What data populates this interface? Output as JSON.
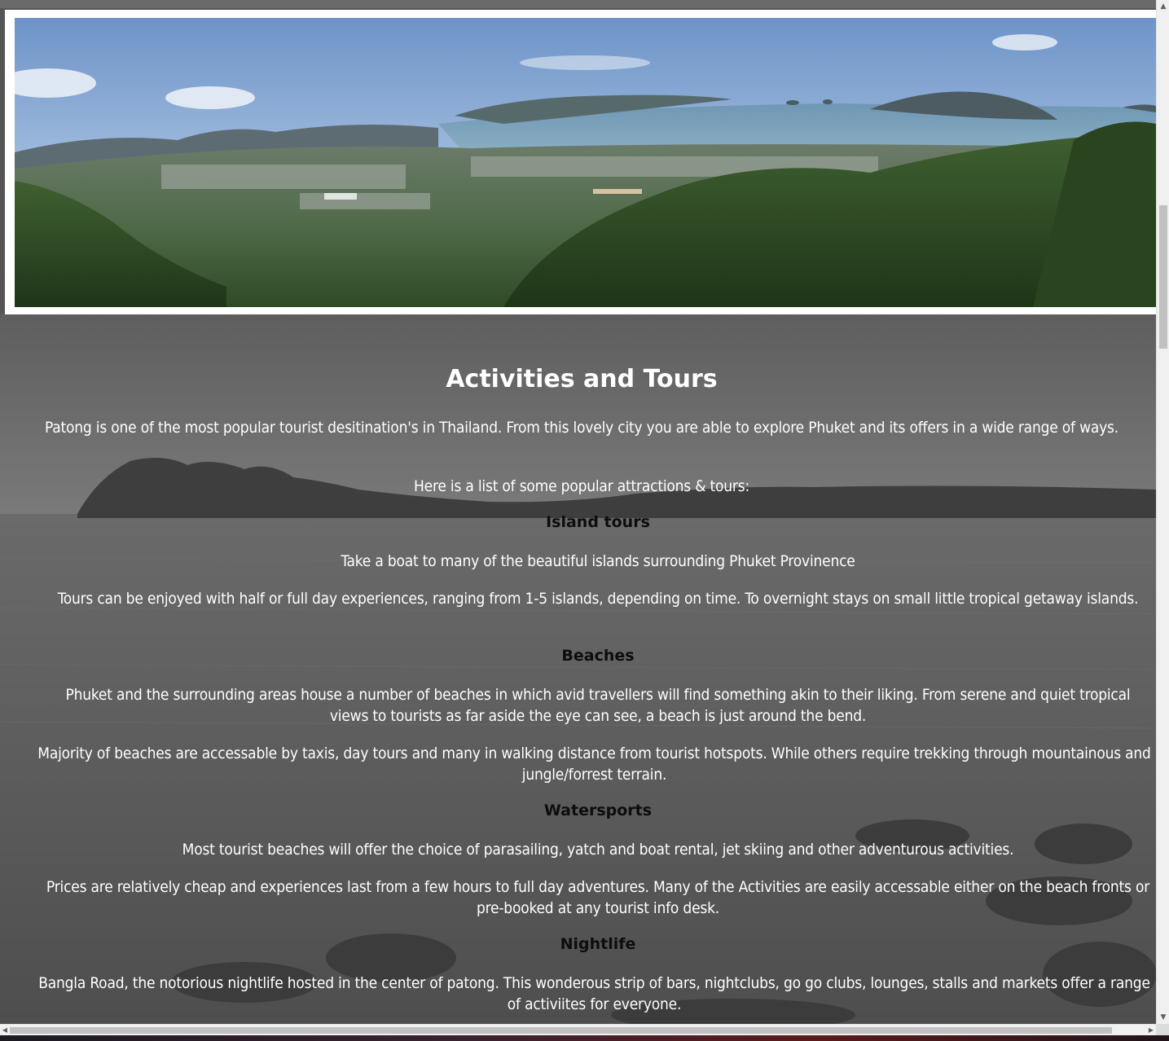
{
  "banner": {
    "alt": "Panoramic view over Phuket bay and islands"
  },
  "main": {
    "title": "Activities and Tours",
    "intro": "Patong is one of the most popular tourist desitination's in Thailand. From this lovely city you are able to explore Phuket and its offers in a wide range of ways.",
    "list_intro": "Here is a list of some popular attractions & tours:",
    "sections": [
      {
        "heading": "Island tours",
        "paragraphs": [
          "Take a boat to many of the beautiful islands surrounding Phuket Provinence",
          "Tours can be enjoyed with half or full day experiences, ranging from 1-5 islands, depending on time. To overnight stays on small little tropical getaway islands."
        ]
      },
      {
        "heading": "Beaches",
        "paragraphs": [
          "Phuket and the surrounding areas house a number of beaches in which avid travellers will find something akin to their liking. From serene and quiet tropical views to tourists as far aside the eye can see, a beach is just around the bend.",
          "Majority of beaches are accessable by taxis, day tours and many in walking distance from tourist hotspots. While others require trekking through mountainous and jungle/forrest terrain."
        ]
      },
      {
        "heading": "Watersports",
        "paragraphs": [
          "Most tourist beaches will offer the choice of parasailing, yatch and boat rental, jet skiing and other adventurous activities.",
          "Prices are relatively cheap and experiences last from a few hours to full day adventures. Many of the Activities are easily accessable either on the beach fronts or pre-booked at any tourist info desk."
        ]
      },
      {
        "heading": "Nightlife",
        "paragraphs": [
          "Bangla Road, the notorious nightlife hosted in the center of patong. This wonderous strip of bars, nightclubs, go go clubs, lounges, stalls and markets offer a range of activiites for everyone."
        ]
      }
    ]
  },
  "scrollbars": {
    "up_icon": "arrow-up-icon",
    "down_icon": "arrow-down-icon",
    "left_icon": "arrow-left-icon",
    "right_icon": "arrow-right-icon"
  },
  "colors": {
    "text": "#ffffff",
    "heading": "#0d0d0d",
    "banner_border": "#ffffff"
  }
}
